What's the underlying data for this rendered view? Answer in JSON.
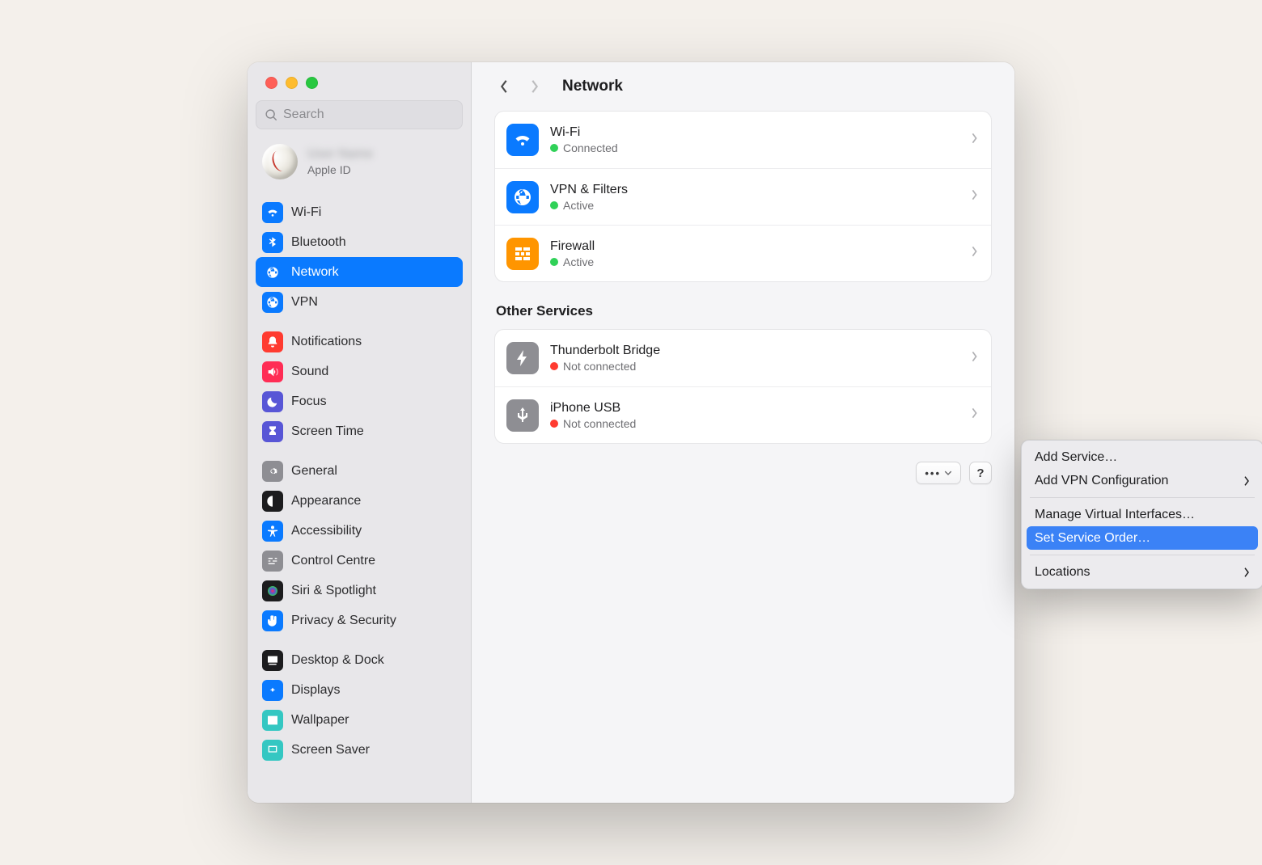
{
  "header": {
    "title": "Network"
  },
  "search": {
    "placeholder": "Search"
  },
  "account": {
    "name": "User Name",
    "subtitle": "Apple ID"
  },
  "sidebar": {
    "groups": [
      [
        {
          "label": "Wi-Fi",
          "icon": "wifi",
          "bg": "#0a7aff"
        },
        {
          "label": "Bluetooth",
          "icon": "bluetooth",
          "bg": "#0a7aff"
        },
        {
          "label": "Network",
          "icon": "globe",
          "bg": "#0a7aff",
          "selected": true
        },
        {
          "label": "VPN",
          "icon": "globe",
          "bg": "#0a7aff"
        }
      ],
      [
        {
          "label": "Notifications",
          "icon": "bell",
          "bg": "#ff3b30"
        },
        {
          "label": "Sound",
          "icon": "speaker",
          "bg": "#ff2d55"
        },
        {
          "label": "Focus",
          "icon": "moon",
          "bg": "#5856d6"
        },
        {
          "label": "Screen Time",
          "icon": "hourglass",
          "bg": "#5856d6"
        }
      ],
      [
        {
          "label": "General",
          "icon": "gear",
          "bg": "#8e8e93"
        },
        {
          "label": "Appearance",
          "icon": "appearance",
          "bg": "#1c1c1e"
        },
        {
          "label": "Accessibility",
          "icon": "access",
          "bg": "#0a7aff"
        },
        {
          "label": "Control Centre",
          "icon": "switches",
          "bg": "#8e8e93"
        },
        {
          "label": "Siri & Spotlight",
          "icon": "siri",
          "bg": "#1c1c1e"
        },
        {
          "label": "Privacy & Security",
          "icon": "hand",
          "bg": "#0a7aff"
        }
      ],
      [
        {
          "label": "Desktop & Dock",
          "icon": "dock",
          "bg": "#1c1c1e"
        },
        {
          "label": "Displays",
          "icon": "displays",
          "bg": "#0a7aff"
        },
        {
          "label": "Wallpaper",
          "icon": "wallpaper",
          "bg": "#34c7c2"
        },
        {
          "label": "Screen Saver",
          "icon": "screensaver",
          "bg": "#34c7c2"
        }
      ]
    ]
  },
  "services": {
    "primary": [
      {
        "title": "Wi-Fi",
        "status": "Connected",
        "dot": "green",
        "icon": "wifi",
        "bg": "#0a7aff"
      },
      {
        "title": "VPN & Filters",
        "status": "Active",
        "dot": "green",
        "icon": "globe",
        "bg": "#0a7aff"
      },
      {
        "title": "Firewall",
        "status": "Active",
        "dot": "green",
        "icon": "firewall",
        "bg": "#ff9500"
      }
    ],
    "other_label": "Other Services",
    "other": [
      {
        "title": "Thunderbolt Bridge",
        "status": "Not connected",
        "dot": "red",
        "icon": "bolt",
        "bg": "#8e8e93"
      },
      {
        "title": "iPhone USB",
        "status": "Not connected",
        "dot": "red",
        "icon": "usb",
        "bg": "#8e8e93"
      }
    ]
  },
  "menu": {
    "items": [
      {
        "label": "Add Service…"
      },
      {
        "label": "Add VPN Configuration",
        "submenu": true
      },
      {
        "sep": true
      },
      {
        "label": "Manage Virtual Interfaces…"
      },
      {
        "label": "Set Service Order…",
        "highlight": true
      },
      {
        "sep": true
      },
      {
        "label": "Locations",
        "submenu": true
      }
    ]
  },
  "help_glyph": "?"
}
